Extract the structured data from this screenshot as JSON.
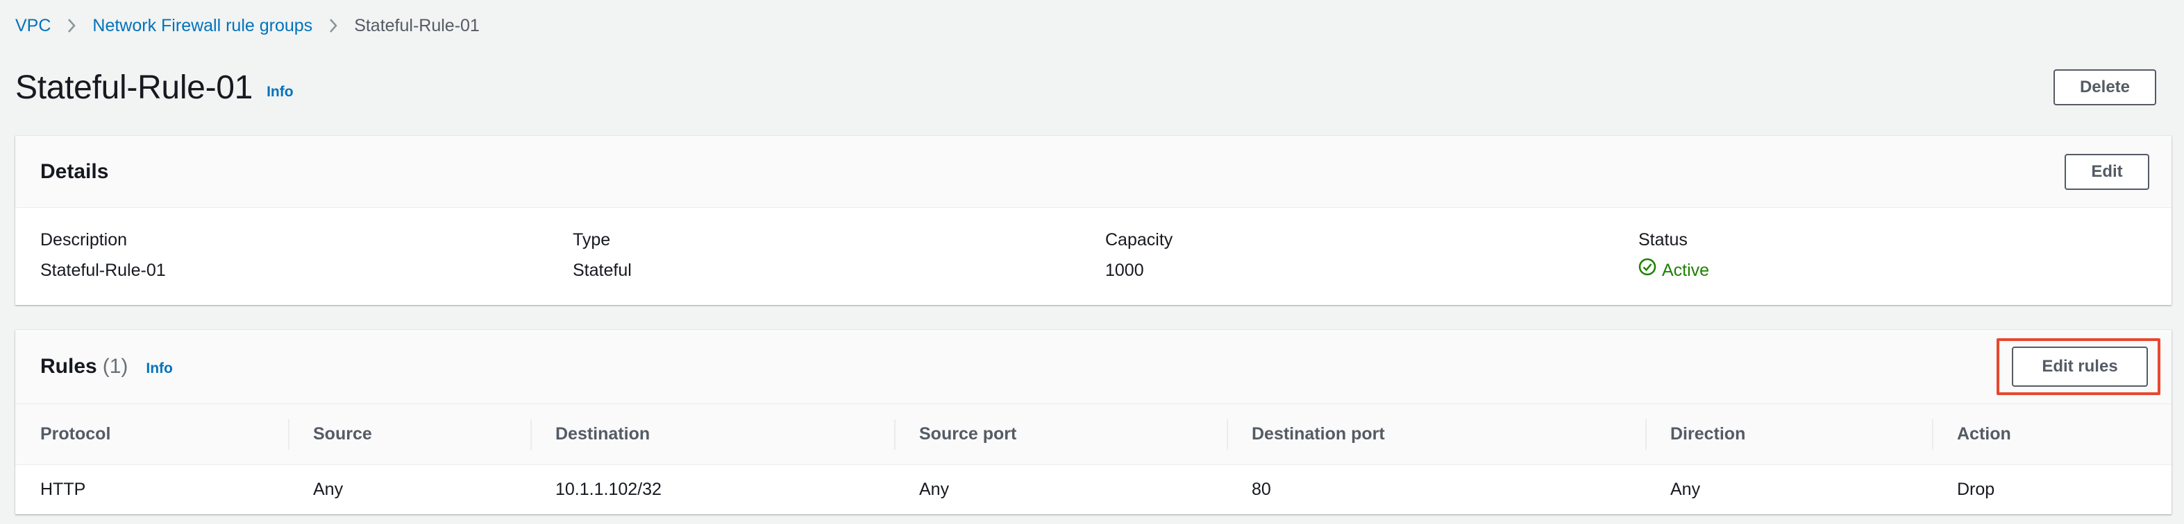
{
  "breadcrumb": {
    "items": [
      {
        "label": "VPC",
        "link": true
      },
      {
        "label": "Network Firewall rule groups",
        "link": true
      },
      {
        "label": "Stateful-Rule-01",
        "link": false
      }
    ]
  },
  "header": {
    "title": "Stateful-Rule-01",
    "info_label": "Info",
    "delete_label": "Delete"
  },
  "details": {
    "title": "Details",
    "edit_label": "Edit",
    "fields": [
      {
        "label": "Description",
        "value": "Stateful-Rule-01"
      },
      {
        "label": "Type",
        "value": "Stateful"
      },
      {
        "label": "Capacity",
        "value": "1000"
      },
      {
        "label": "Status",
        "value": "Active"
      }
    ]
  },
  "rules": {
    "title": "Rules",
    "count": "(1)",
    "info_label": "Info",
    "edit_rules_label": "Edit rules",
    "columns": [
      "Protocol",
      "Source",
      "Destination",
      "Source port",
      "Destination port",
      "Direction",
      "Action"
    ],
    "rows": [
      [
        "HTTP",
        "Any",
        "10.1.1.102/32",
        "Any",
        "80",
        "Any",
        "Drop"
      ]
    ]
  },
  "colors": {
    "link": "#0073bb",
    "status_active": "#1d8102",
    "highlight": "#e8472f"
  }
}
